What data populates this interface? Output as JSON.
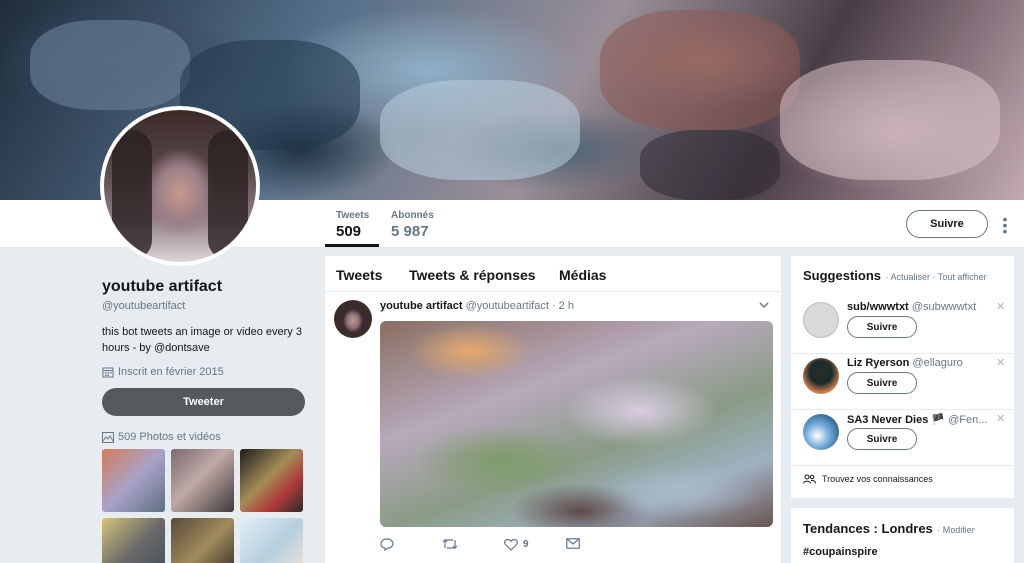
{
  "profile": {
    "name": "youtube artifact",
    "handle": "@youtubeartifact",
    "bio": "this bot tweets an image or video every 3 hours - by @dontsave",
    "joined": "Inscrit en février 2015",
    "tweet_button": "Tweeter",
    "media_count": "509 Photos et vidéos"
  },
  "stats": {
    "tweets_label": "Tweets",
    "tweets_value": "509",
    "followers_label": "Abonnés",
    "followers_value": "5 987"
  },
  "actions": {
    "follow": "Suivre"
  },
  "timeline": {
    "tabs": [
      "Tweets",
      "Tweets & réponses",
      "Médias"
    ],
    "tweet": {
      "name": "youtube artifact",
      "handle": "@youtubeartifact · 2 h",
      "likes": "9"
    }
  },
  "suggestions": {
    "title": "Suggestions",
    "links": "· Actualiser · Tout afficher",
    "items": [
      {
        "name": "sub/wwwtxt",
        "handle": "@subwwwtxt",
        "button": "Suivre"
      },
      {
        "name": "Liz Ryerson",
        "handle": "@ellaguro",
        "button": "Suivre"
      },
      {
        "name": "SA3 Never Dies 🏴",
        "handle": "@Fen...",
        "button": "Suivre"
      }
    ],
    "find": "Trouvez vos connaissances"
  },
  "trends": {
    "title": "Tendances : Londres",
    "link": "· Modifier",
    "first": "#coupainspire"
  }
}
